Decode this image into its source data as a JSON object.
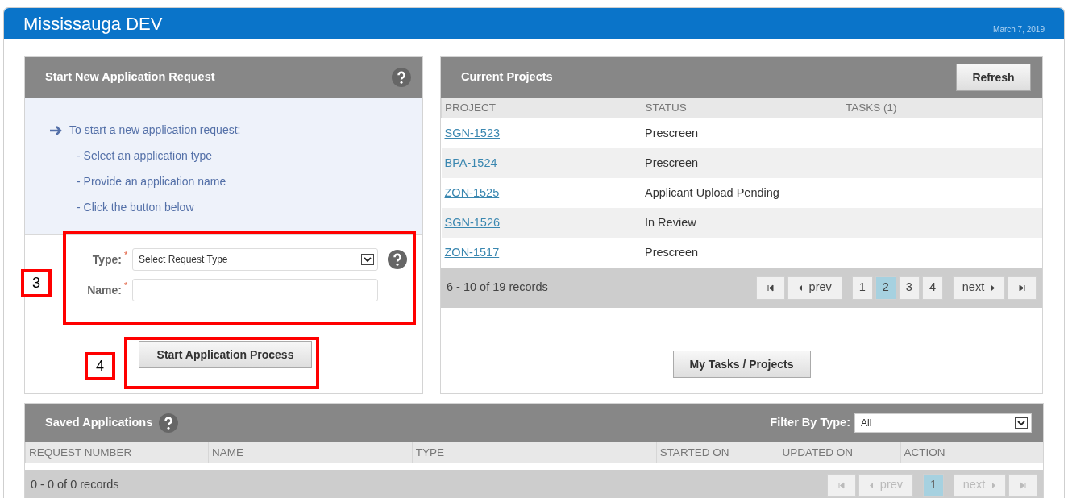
{
  "header": {
    "title": "Mississauga DEV",
    "date": "March 7, 2019"
  },
  "new_request": {
    "title": "Start New Application Request",
    "help": true,
    "instructions": {
      "lead": "To start a new application request:",
      "steps": [
        "- Select an application type",
        "- Provide an application name",
        "- Click the button below"
      ]
    },
    "fields": [
      {
        "kind": "select",
        "label": "Type:",
        "required_mark": "*",
        "value": "Select Request Type",
        "help": true
      },
      {
        "kind": "text",
        "label": "Name:",
        "required_mark": "*",
        "help": false
      }
    ],
    "button": "Start Application Process"
  },
  "annotations": [
    {
      "label": "3"
    },
    {
      "label": "4"
    }
  ],
  "current_projects": {
    "title": "Current Projects",
    "refresh_button": "Refresh",
    "columns": [
      "PROJECT",
      "STATUS",
      "TASKS (1)"
    ],
    "rows": [
      {
        "project": "SGN-1523",
        "status": "Prescreen"
      },
      {
        "project": "BPA-1524",
        "status": "Prescreen"
      },
      {
        "project": "ZON-1525",
        "status": "Applicant Upload Pending"
      },
      {
        "project": "SGN-1526",
        "status": "In Review"
      },
      {
        "project": "ZON-1517",
        "status": "Prescreen"
      }
    ],
    "records": "6 - 10 of 19 records",
    "pager": {
      "disabled": false,
      "prev": "prev",
      "next": "next",
      "pages": [
        {
          "label": "1",
          "selected": false
        },
        {
          "label": "2",
          "selected": true
        },
        {
          "label": "3",
          "selected": false
        },
        {
          "label": "4",
          "selected": false
        }
      ]
    },
    "button": "My Tasks / Projects"
  },
  "saved_applications": {
    "title": "Saved Applications",
    "help": true,
    "filter_label": "Filter By Type:",
    "filter_value": "All",
    "columns": [
      "REQUEST NUMBER",
      "NAME",
      "TYPE",
      "STARTED ON",
      "UPDATED ON",
      "ACTION"
    ],
    "records": "0 - 0 of 0 records",
    "pager": {
      "disabled": true,
      "prev": "prev",
      "next": "next",
      "pages": [
        {
          "label": "1",
          "selected": true
        }
      ]
    }
  }
}
